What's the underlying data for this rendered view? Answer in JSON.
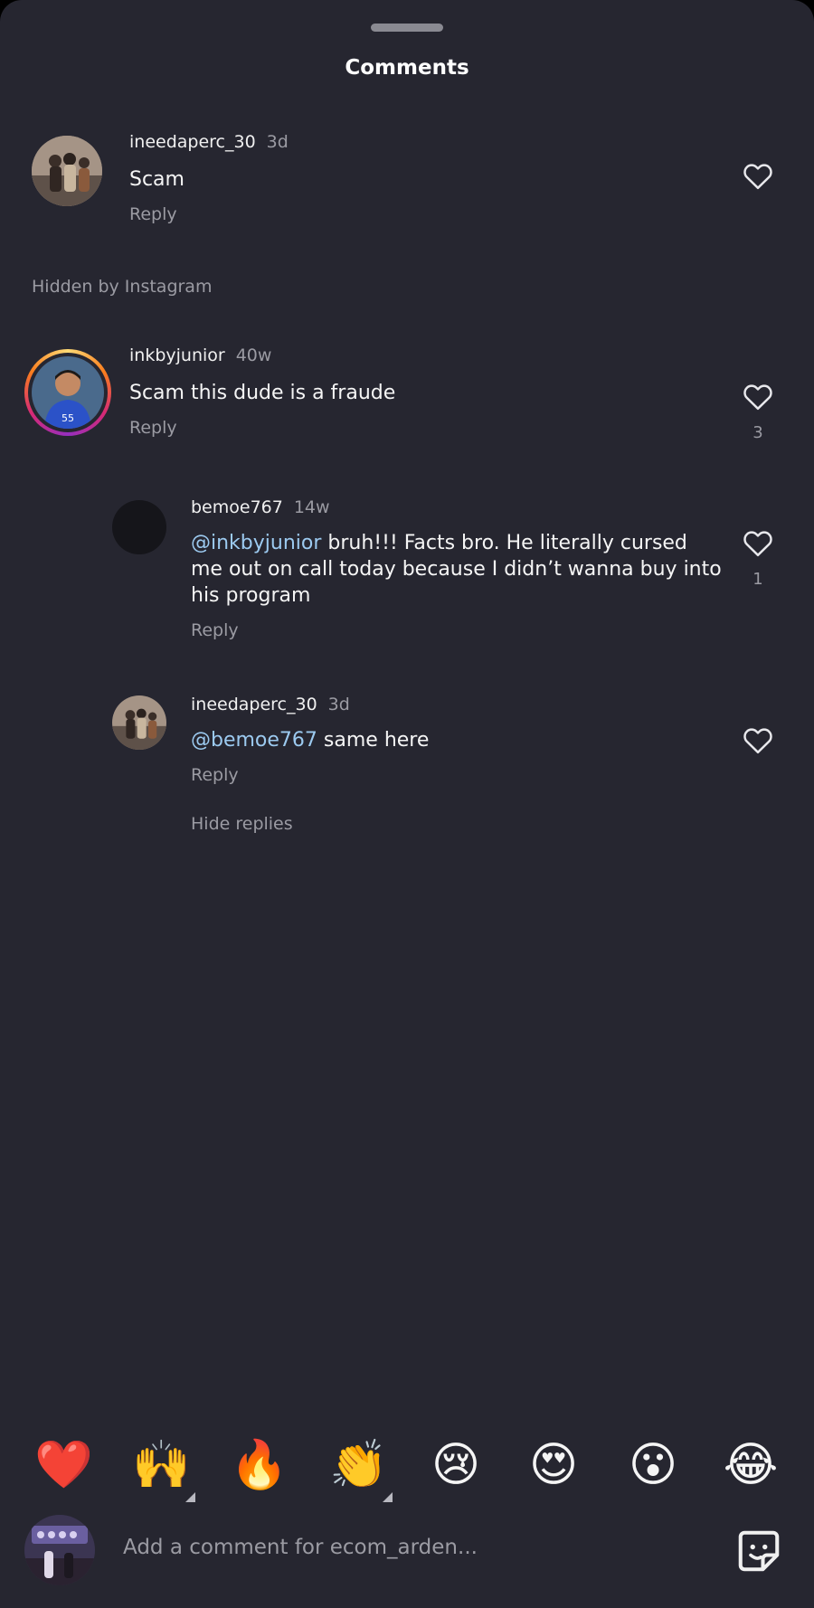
{
  "sheet": {
    "title": "Comments"
  },
  "comments": [
    {
      "username": "ineedaperc_30",
      "time": "3d",
      "text": "Scam",
      "reply_label": "Reply",
      "likes": null
    },
    {
      "username": "inkbyjunior",
      "time": "40w",
      "text": "Scam this dude is a fraude",
      "reply_label": "Reply",
      "likes": "3"
    }
  ],
  "hidden_note": "Hidden by Instagram",
  "replies": [
    {
      "username": "bemoe767",
      "time": "14w",
      "mention": "@inkbyjunior",
      "text_lines": [
        "bruh!!! Facts bro. He literally cursed",
        "me out on call today because I didn’t wanna buy into",
        "his program"
      ],
      "reply_label": "Reply",
      "likes": "1"
    },
    {
      "username": "ineedaperc_30",
      "time": "3d",
      "mention": "@bemoe767",
      "text": "same here",
      "reply_label": "Reply",
      "likes": null
    }
  ],
  "hide_replies_label": "Hide replies",
  "reactions": [
    {
      "emoji": "❤️",
      "name": "heart-emoji"
    },
    {
      "emoji": "🙌",
      "name": "raising-hands-emoji",
      "has_skin_tone": true
    },
    {
      "emoji": "🔥",
      "name": "fire-emoji"
    },
    {
      "emoji": "👏",
      "name": "clapping-hands-emoji",
      "has_skin_tone": true
    },
    {
      "emoji": "😢",
      "name": "crying-face-emoji"
    },
    {
      "emoji": "😍",
      "name": "heart-eyes-emoji"
    },
    {
      "emoji": "😮",
      "name": "surprised-face-emoji"
    },
    {
      "emoji": "😂",
      "name": "tears-of-joy-emoji"
    }
  ],
  "composer": {
    "placeholder": "Add a comment for ecom_arden..."
  },
  "colors": {
    "background": "#262630",
    "mention": "#9ccaf0",
    "muted": "#9b9ba3",
    "story_ring": "#e1306c"
  }
}
